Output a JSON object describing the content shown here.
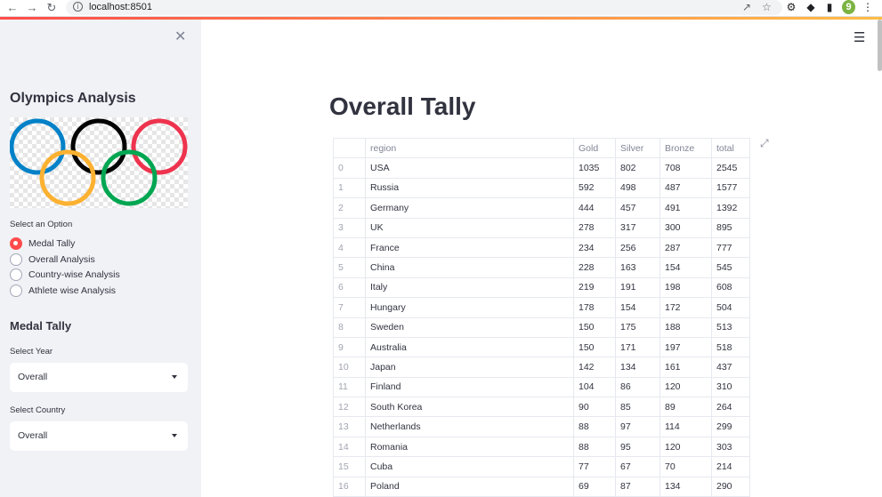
{
  "browser": {
    "url": "localhost:8501",
    "ext_badge": "9"
  },
  "sidebar": {
    "close_icon": "close-icon",
    "title": "Olympics Analysis",
    "option_label": "Select an Option",
    "options": [
      "Medal Tally",
      "Overall Analysis",
      "Country-wise Analysis",
      "Athlete wise Analysis"
    ],
    "selected_option": "Medal Tally",
    "section_title": "Medal Tally",
    "year_label": "Select Year",
    "year_value": "Overall",
    "country_label": "Select Country",
    "country_value": "Overall",
    "accent_color": "#ff4b4b"
  },
  "main": {
    "title": "Overall Tally",
    "columns": [
      "",
      "region",
      "Gold",
      "Silver",
      "Bronze",
      "total"
    ],
    "rows": [
      [
        "0",
        "USA",
        "1035",
        "802",
        "708",
        "2545"
      ],
      [
        "1",
        "Russia",
        "592",
        "498",
        "487",
        "1577"
      ],
      [
        "2",
        "Germany",
        "444",
        "457",
        "491",
        "1392"
      ],
      [
        "3",
        "UK",
        "278",
        "317",
        "300",
        "895"
      ],
      [
        "4",
        "France",
        "234",
        "256",
        "287",
        "777"
      ],
      [
        "5",
        "China",
        "228",
        "163",
        "154",
        "545"
      ],
      [
        "6",
        "Italy",
        "219",
        "191",
        "198",
        "608"
      ],
      [
        "7",
        "Hungary",
        "178",
        "154",
        "172",
        "504"
      ],
      [
        "8",
        "Sweden",
        "150",
        "175",
        "188",
        "513"
      ],
      [
        "9",
        "Australia",
        "150",
        "171",
        "197",
        "518"
      ],
      [
        "10",
        "Japan",
        "142",
        "134",
        "161",
        "437"
      ],
      [
        "11",
        "Finland",
        "104",
        "86",
        "120",
        "310"
      ],
      [
        "12",
        "South Korea",
        "90",
        "85",
        "89",
        "264"
      ],
      [
        "13",
        "Netherlands",
        "88",
        "97",
        "114",
        "299"
      ],
      [
        "14",
        "Romania",
        "88",
        "95",
        "120",
        "303"
      ],
      [
        "15",
        "Cuba",
        "77",
        "67",
        "70",
        "214"
      ],
      [
        "16",
        "Poland",
        "69",
        "87",
        "134",
        "290"
      ]
    ]
  }
}
